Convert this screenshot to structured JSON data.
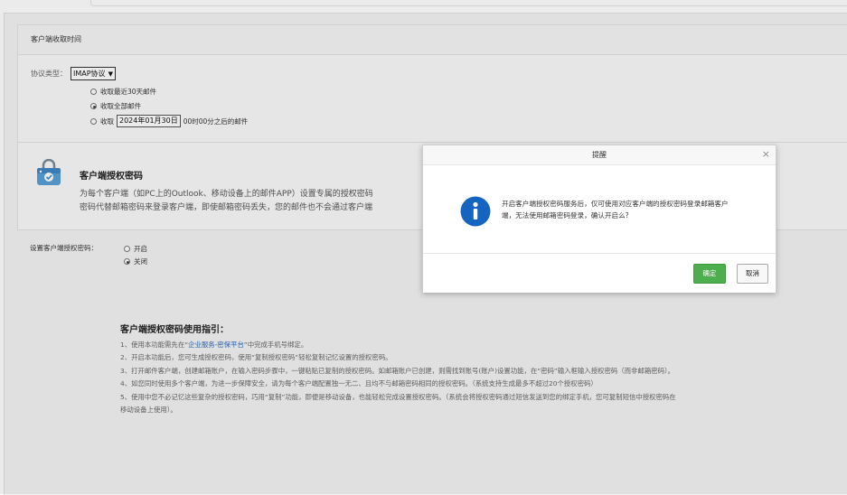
{
  "fetch_panel": {
    "header": "客户端收取时间",
    "protocol_label": "协议类型：",
    "protocol_value": "IMAP协议",
    "options": [
      {
        "label": "收取最近30天邮件",
        "checked": false
      },
      {
        "label": "收取全部邮件",
        "checked": true
      }
    ],
    "custom_prefix": "收取",
    "custom_date": "2024年01月30日",
    "custom_suffix": "00时00分之后的邮件"
  },
  "auth_panel": {
    "title": "客户端授权密码",
    "desc_line1": "为每个客户端（如PC上的Outlook、移动设备上的邮件APP）设置专属的授权密码",
    "desc_line2": "密码代替邮箱密码来登录客户端，即使邮箱密码丢失，您的邮件也不会通过客户端"
  },
  "setting": {
    "label": "设置客户端授权密码：",
    "on_label": "开启",
    "off_label": "关闭",
    "selected": "off"
  },
  "guide": {
    "title": "客户端授权密码使用指引：",
    "item1_pre": "1、使用本功能需先在“",
    "item1_link": "企业服务-密保平台",
    "item1_post": "”中完成手机号绑定。",
    "item2": "2、开启本功能后，您可生成授权密码，使用“复制授权密码”轻松复制记忆设置的授权密码。",
    "item3": "3、打开邮件客户端，创建邮箱账户，在输入密码步骤中，一键粘贴已复制的授权密码。如邮箱账户已创建，则需找到账号(账户)设置功能，在“密码”输入框输入授权密码（而非邮箱密码）。",
    "item4": "4、如您同时使用多个客户端，为进一步保障安全，请为每个客户端配置独一无二、且均不与邮箱密码相同的授权密码。（系统支持生成最多不超过20个授权密码）",
    "item5": "5、使用中您不必记忆这些复杂的授权密码，巧用“复制”功能，即便是移动设备，也能轻松完成设置授权密码。（系统会将授权密码通过短信发送到您的绑定手机，您可复制短信中授权密码在移动设备上使用）。"
  },
  "modal": {
    "title": "提醒",
    "close_glyph": "×",
    "message": "开启客户端授权密码服务后，仅可使用对应客户端的授权密码登录邮箱客户端，无法使用邮箱密码登录，确认开启么?",
    "confirm_label": "确定",
    "cancel_label": "取消",
    "icon": "info-icon",
    "icon_color": "#1565c0",
    "confirm_color": "#4cae4c"
  }
}
